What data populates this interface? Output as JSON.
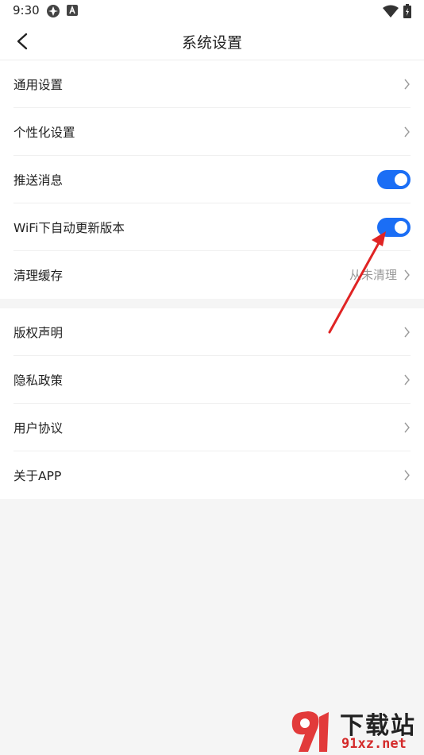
{
  "status_bar": {
    "time": "9:30",
    "icons": [
      "app-notification-icon",
      "a-square-icon",
      "wifi-icon",
      "battery-icon"
    ]
  },
  "header": {
    "title": "系统设置",
    "back_icon": "chevron-left-icon"
  },
  "group_general": {
    "items": [
      {
        "label": "通用设置",
        "control": "chevron"
      },
      {
        "label": "个性化设置",
        "control": "chevron"
      },
      {
        "label": "推送消息",
        "control": "toggle",
        "enabled": true
      },
      {
        "label": "WiFi下自动更新版本",
        "control": "toggle",
        "enabled": true
      },
      {
        "label": "清理缓存",
        "value": "从未清理",
        "control": "chevron"
      }
    ]
  },
  "group_about": {
    "items": [
      {
        "label": "版权声明",
        "control": "chevron"
      },
      {
        "label": "隐私政策",
        "control": "chevron"
      },
      {
        "label": "用户协议",
        "control": "chevron"
      },
      {
        "label": "关于APP",
        "control": "chevron"
      }
    ]
  },
  "watermark": {
    "title": "下载站",
    "url": "91xz.net"
  },
  "colors": {
    "accent": "#1b6ef5",
    "annotation": "#e02424",
    "background": "#f5f5f5"
  }
}
